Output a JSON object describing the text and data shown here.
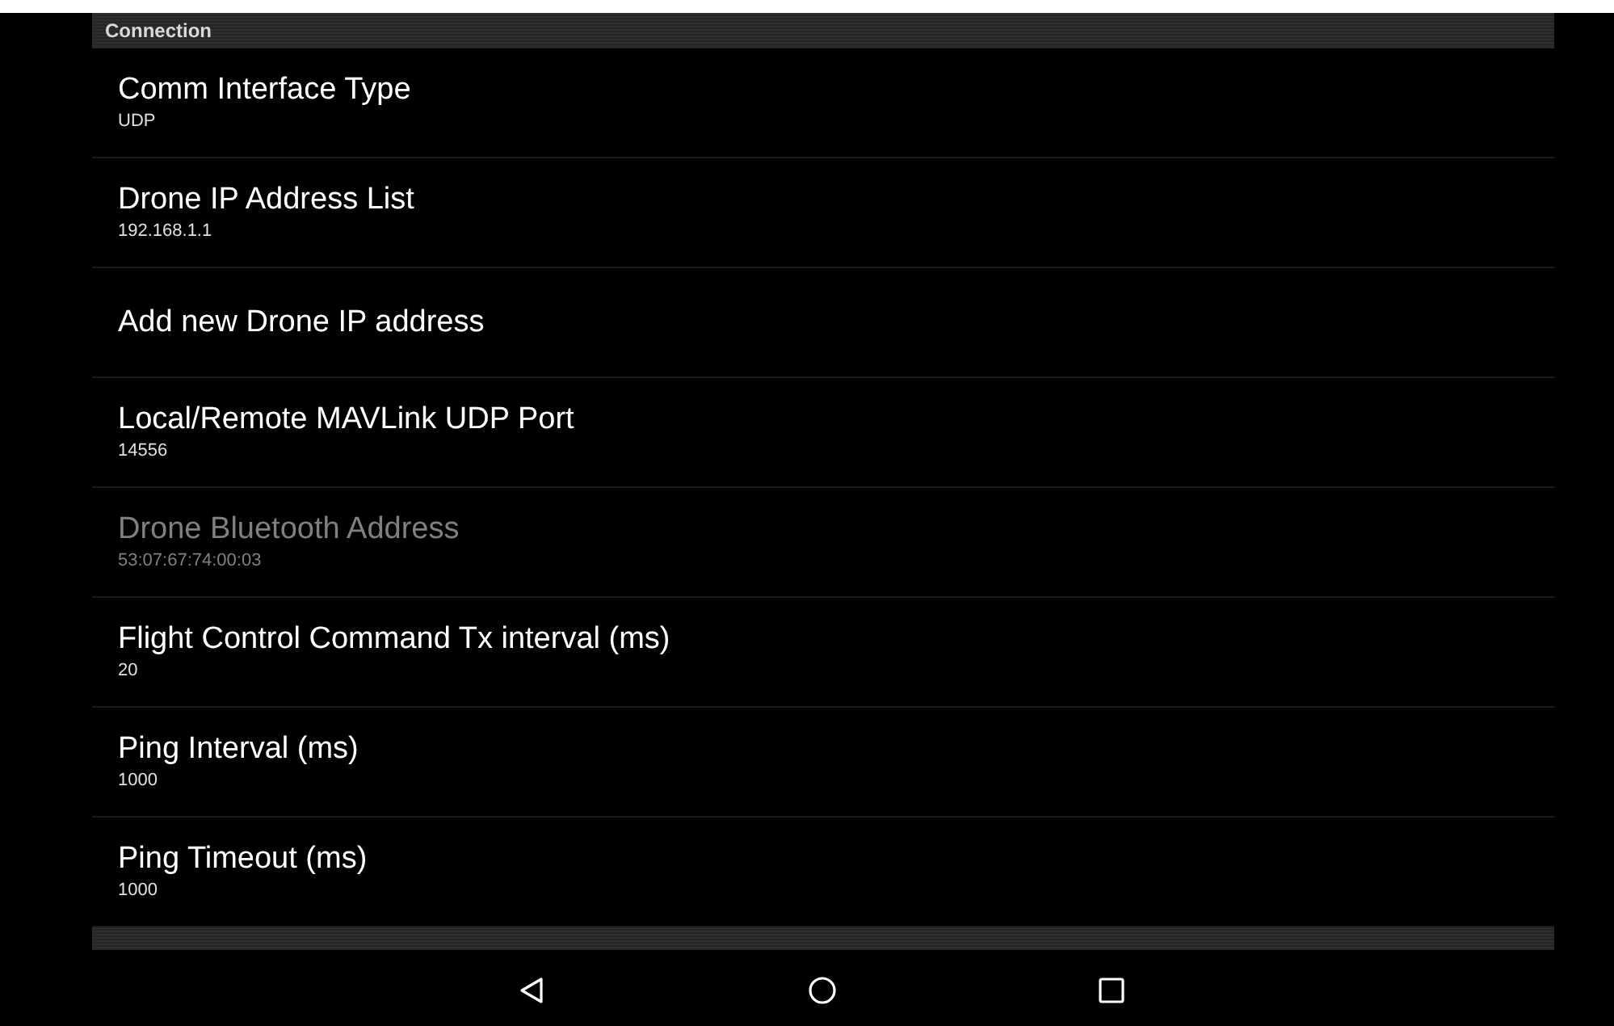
{
  "sections": [
    {
      "title": "Connection",
      "items": [
        {
          "title": "Comm Interface Type",
          "summary": "UDP",
          "disabled": false
        },
        {
          "title": "Drone IP Address List",
          "summary": "192.168.1.1",
          "disabled": false
        },
        {
          "title": "Add new Drone IP address",
          "disabled": false
        },
        {
          "title": "Local/Remote MAVLink UDP Port",
          "summary": "14556",
          "disabled": false
        },
        {
          "title": "Drone Bluetooth Address",
          "summary": "53:07:67:74:00:03",
          "disabled": true
        },
        {
          "title": "Flight Control Command Tx interval (ms)",
          "summary": "20",
          "disabled": false
        },
        {
          "title": "Ping Interval (ms)",
          "summary": "1000",
          "disabled": false
        },
        {
          "title": "Ping Timeout (ms)",
          "summary": "1000",
          "disabled": false
        }
      ]
    }
  ],
  "nav_bar": {
    "buttons": [
      {
        "kind": "back"
      },
      {
        "kind": "home"
      },
      {
        "kind": "recents"
      }
    ]
  }
}
